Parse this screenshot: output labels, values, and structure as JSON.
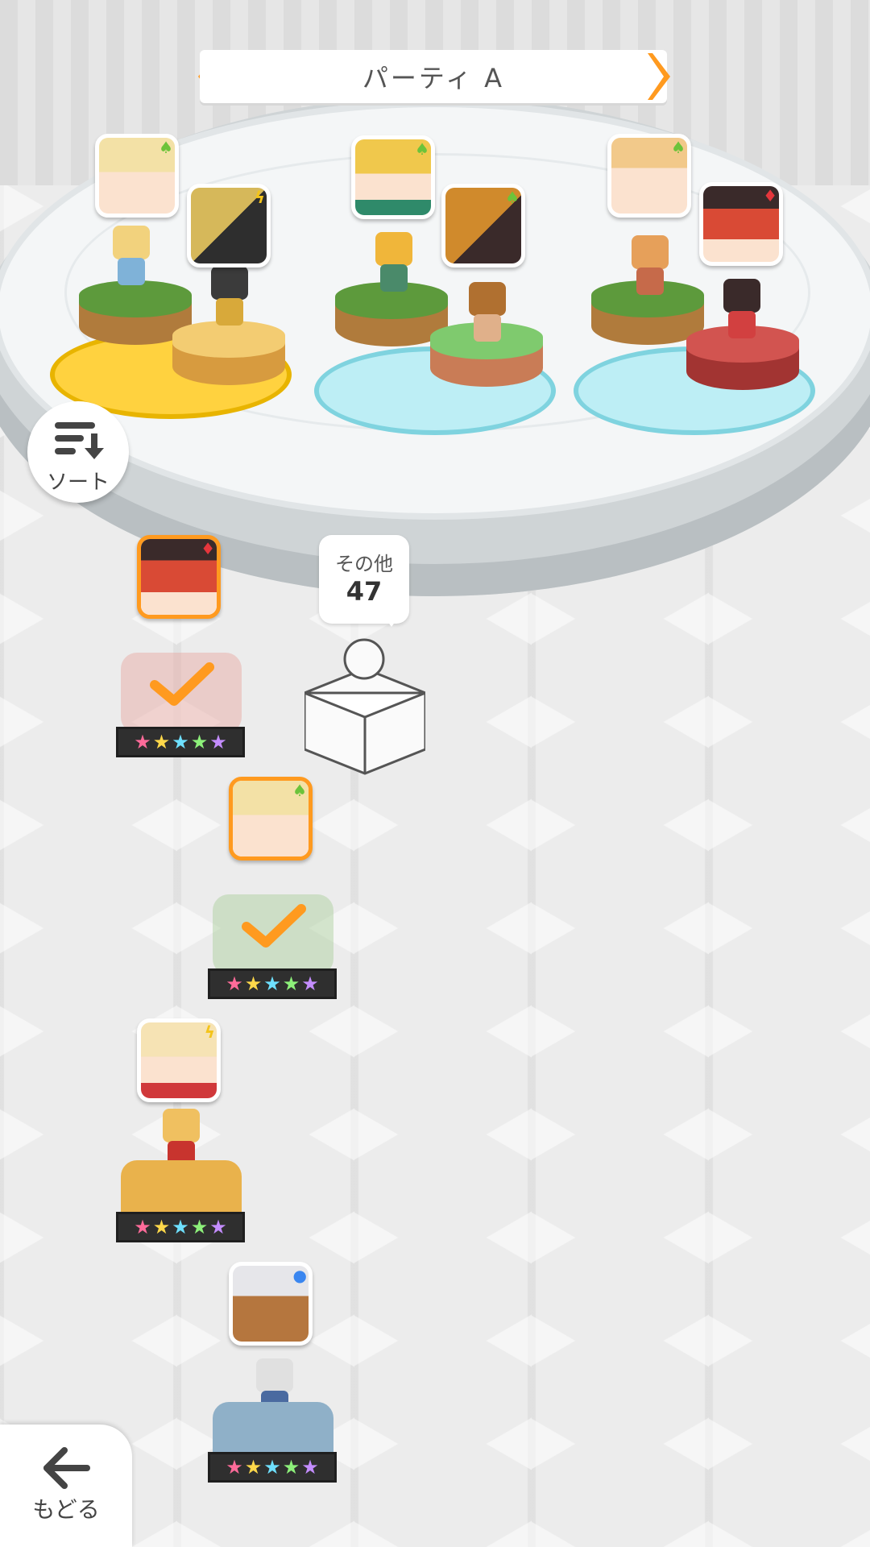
{
  "header": {
    "title": "パーティ A"
  },
  "sort_button": {
    "label": "ソート",
    "icon": "sort-icon"
  },
  "others": {
    "label": "その他",
    "count": "47"
  },
  "back_button": {
    "label": "もどる",
    "icon": "back-arrow-icon"
  },
  "party_slots": [
    {
      "element": "wind",
      "portraits": [
        {
          "hair": "#f3d98c",
          "element": "wind"
        },
        {
          "hair": "#d6b85a",
          "element": "thunder"
        }
      ]
    },
    {
      "element": "wind",
      "portraits": [
        {
          "hair": "#f0c84c",
          "element": "wind"
        },
        {
          "hair": "#d08a2c",
          "element": "wind"
        }
      ]
    },
    {
      "element": "fire",
      "portraits": [
        {
          "hair": "#f2c98a",
          "element": "wind"
        },
        {
          "hair": "#d94a35",
          "element": "fire"
        }
      ]
    }
  ],
  "roster": [
    {
      "element": "fire",
      "stars": 5,
      "selected": true
    },
    {
      "element": "wind",
      "stars": 5,
      "selected": true
    },
    {
      "element": "thunder",
      "stars": 5,
      "selected": false
    },
    {
      "element": "water",
      "stars": 5,
      "selected": false
    }
  ],
  "colors": {
    "accent": "#ff9a1f",
    "wind": "#6cc33a",
    "thunder": "#f4c41a",
    "fire": "#e5363c",
    "water": "#3a86f0"
  }
}
